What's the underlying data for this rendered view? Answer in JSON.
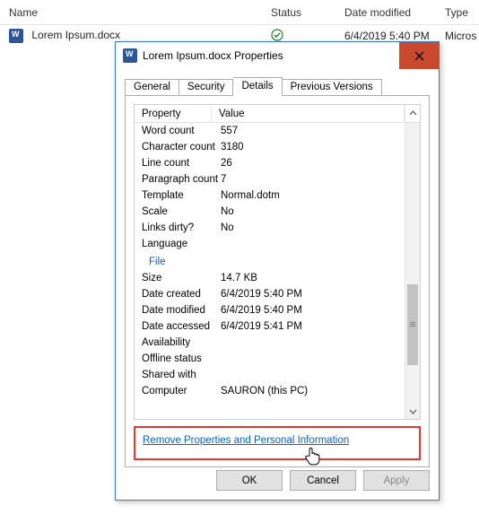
{
  "explorer": {
    "columns": {
      "name": "Name",
      "status": "Status",
      "date": "Date modified",
      "type": "Type"
    },
    "row": {
      "filename": "Lorem Ipsum.docx",
      "date": "6/4/2019 5:40 PM",
      "type": "Micros"
    }
  },
  "dialog": {
    "title": "Lorem Ipsum.docx Properties",
    "tabs": {
      "general": "General",
      "security": "Security",
      "details": "Details",
      "versions": "Previous Versions"
    },
    "headers": {
      "property": "Property",
      "value": "Value"
    },
    "props": [
      {
        "k": "Word count",
        "v": "557"
      },
      {
        "k": "Character count",
        "v": "3180"
      },
      {
        "k": "Line count",
        "v": "26"
      },
      {
        "k": "Paragraph count",
        "v": "7"
      },
      {
        "k": "Template",
        "v": "Normal.dotm"
      },
      {
        "k": "Scale",
        "v": "No"
      },
      {
        "k": "Links dirty?",
        "v": "No"
      },
      {
        "k": "Language",
        "v": ""
      }
    ],
    "section": "File",
    "fileprops": [
      {
        "k": "Size",
        "v": "14.7 KB"
      },
      {
        "k": "Date created",
        "v": "6/4/2019 5:40 PM"
      },
      {
        "k": "Date modified",
        "v": "6/4/2019 5:40 PM"
      },
      {
        "k": "Date accessed",
        "v": "6/4/2019 5:41 PM"
      },
      {
        "k": "Availability",
        "v": ""
      },
      {
        "k": "Offline status",
        "v": ""
      },
      {
        "k": "Shared with",
        "v": ""
      },
      {
        "k": "Computer",
        "v": "SAURON (this PC)"
      }
    ],
    "remove_link": "Remove Properties and Personal Information",
    "buttons": {
      "ok": "OK",
      "cancel": "Cancel",
      "apply": "Apply"
    }
  }
}
